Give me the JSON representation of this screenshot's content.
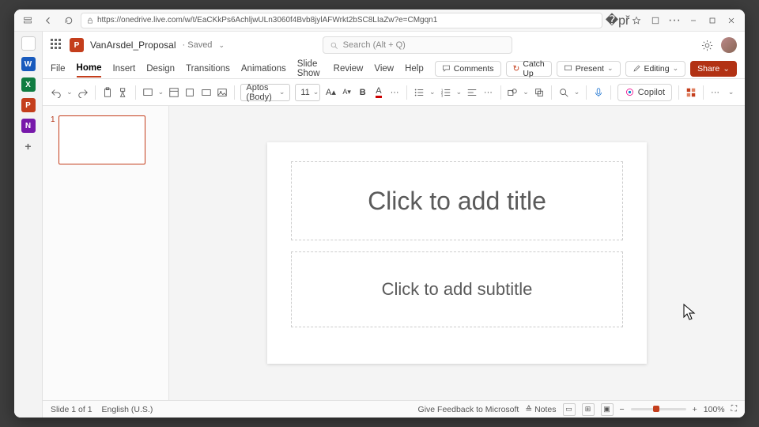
{
  "browser": {
    "url": "https://onedrive.live.com/w/t/EaCKkPs6AchljwULn3060f4Bvb8jylAFWrkt2bSC8LIaZw?e=CMgqn1"
  },
  "rail": {
    "word_letter": "W",
    "excel_letter": "X",
    "ppt_letter": "P",
    "onenote_letter": "N",
    "add": "+"
  },
  "header": {
    "app_letter": "P",
    "doc_name": "VanArsdel_Proposal",
    "saved_state": "· Saved",
    "search_placeholder": "Search (Alt + Q)"
  },
  "tabs": {
    "items": [
      "File",
      "Home",
      "Insert",
      "Design",
      "Transitions",
      "Animations",
      "Slide Show",
      "Review",
      "View",
      "Help"
    ],
    "active_index": 1,
    "comments": "Comments",
    "catchup": "Catch Up",
    "present": "Present",
    "editing": "Editing",
    "share": "Share"
  },
  "ribbon": {
    "font_name": "Aptos (Body)",
    "font_size": "11",
    "bold": "B",
    "copilot": "Copilot",
    "more": "···"
  },
  "thumb": {
    "num": "1"
  },
  "slide": {
    "title_ph": "Click to add title",
    "sub_ph": "Click to add subtitle"
  },
  "status": {
    "slide_info": "Slide 1 of 1",
    "lang": "English (U.S.)",
    "feedback": "Give Feedback to Microsoft",
    "notes": "Notes",
    "zoom": "100%",
    "minus": "−",
    "plus": "+"
  }
}
